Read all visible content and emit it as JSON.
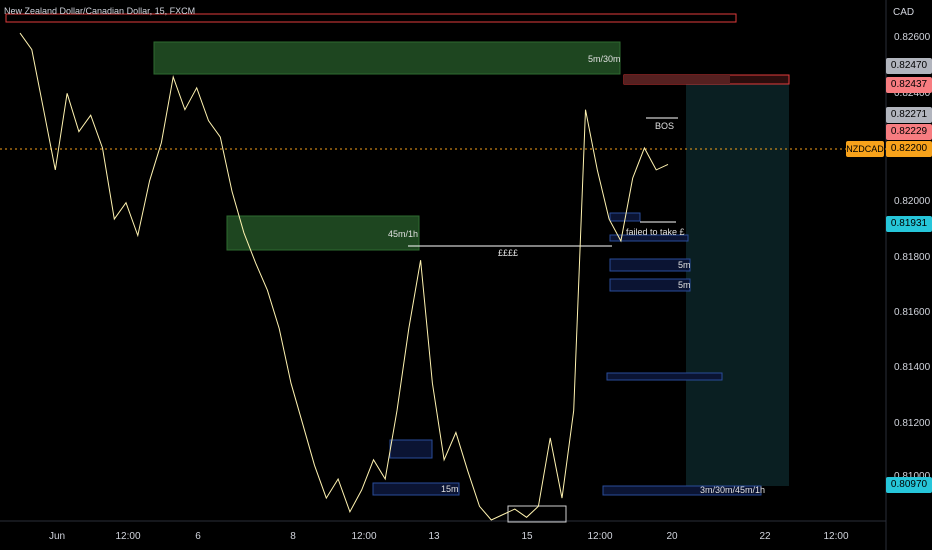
{
  "header": {
    "symbol_title": "New Zealand Dollar/Canadian Dollar, 15, FXCM",
    "currency": "CAD"
  },
  "symbol_tag": "NZDCAD",
  "colors": {
    "price_line": "#fff3b0",
    "bull_zone": "#1e4620",
    "bear_zone": "#0b1433",
    "current_price": "#f7a21b"
  },
  "price_axis": [
    "0.82600",
    "0.82400",
    "0.82000",
    "0.81800",
    "0.81600",
    "0.81400",
    "0.81200",
    "0.81000"
  ],
  "price_labels": [
    {
      "text": "0.82470",
      "bg": "#b2b5be",
      "fg": "#000"
    },
    {
      "text": "0.82437",
      "bg": "#f77c80",
      "fg": "#000"
    },
    {
      "text": "0.82271",
      "bg": "#b2b5be",
      "fg": "#000"
    },
    {
      "text": "0.82229",
      "bg": "#f77c80",
      "fg": "#000"
    },
    {
      "text": "0.82200",
      "bg": "#f7a21b",
      "fg": "#000"
    },
    {
      "text": "0.81931",
      "bg": "#26c6da",
      "fg": "#000"
    },
    {
      "text": "0.80970",
      "bg": "#26c6da",
      "fg": "#000"
    }
  ],
  "time_axis": [
    "Jun",
    "12:00",
    "6",
    "8",
    "12:00",
    "13",
    "15",
    "12:00",
    "20",
    "22",
    "12:00"
  ],
  "annotations": {
    "zone_5m30m": "5m/30m",
    "zone_45m1h": "45m/1h",
    "pounds": "££££",
    "bos": "BOS",
    "failed": "failed to take £",
    "blue_5m_a": "5m",
    "blue_5m_b": "5m",
    "blue_15m": "15m",
    "blue_multi": "3m/30m/45m/1h"
  },
  "chart_data": {
    "type": "line",
    "title": "New Zealand Dollar/Canadian Dollar, 15, FXCM",
    "ylabel": "CAD",
    "ylim": [
      0.809,
      0.8275
    ],
    "current_price": 0.822,
    "series": [
      {
        "values": [
          0.8268,
          0.8262,
          0.824,
          0.8218,
          0.8246,
          0.8232,
          0.8238,
          0.8226,
          0.82,
          0.8206,
          0.8194,
          0.8214,
          0.8228,
          0.8252,
          0.824,
          0.8248,
          0.8236,
          0.823,
          0.821,
          0.8195,
          0.8184,
          0.8174,
          0.816,
          0.814,
          0.8125,
          0.811,
          0.8098,
          0.8105,
          0.8093,
          0.8101,
          0.8112,
          0.8105,
          0.813,
          0.816,
          0.8185,
          0.814,
          0.8112,
          0.8122,
          0.8108,
          0.8095,
          0.809,
          0.8092,
          0.8094,
          0.8091,
          0.8095,
          0.812,
          0.8098,
          0.813,
          0.824,
          0.8218,
          0.82,
          0.8192,
          0.8215,
          0.8226,
          0.8218,
          0.822
        ]
      }
    ]
  }
}
